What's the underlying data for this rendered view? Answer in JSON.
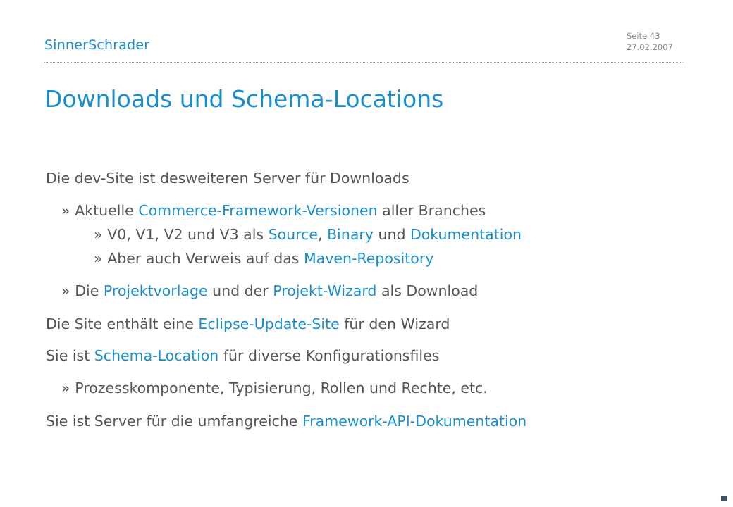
{
  "header": {
    "logo": "SinnerSchrader",
    "page_label": "Seite 43",
    "date": "27.02.2007"
  },
  "slide": {
    "title": "Downloads und Schema-Locations",
    "bullet": "»",
    "lines": [
      {
        "level": 1,
        "parts": [
          {
            "text": "Die dev-Site ist desweiteren Server für Downloads"
          }
        ]
      },
      {
        "level": 2,
        "parts": [
          {
            "text": "Aktuelle "
          },
          {
            "text": "Commerce-Framework-Versionen",
            "link": true
          },
          {
            "text": " aller Branches"
          }
        ]
      },
      {
        "level": 3,
        "parts": [
          {
            "text": "V0, V1, V2 und V3 als "
          },
          {
            "text": "Source",
            "link": true
          },
          {
            "text": ", "
          },
          {
            "text": "Binary",
            "link": true
          },
          {
            "text": " und "
          },
          {
            "text": "Dokumentation",
            "link": true
          }
        ]
      },
      {
        "level": 3,
        "parts": [
          {
            "text": "Aber auch Verweis auf das "
          },
          {
            "text": "Maven-Repository",
            "link": true
          }
        ]
      },
      {
        "level": 2,
        "parts": [
          {
            "text": "Die "
          },
          {
            "text": "Projektvorlage",
            "link": true
          },
          {
            "text": " und der "
          },
          {
            "text": "Projekt-Wizard",
            "link": true
          },
          {
            "text": " als Download"
          }
        ]
      },
      {
        "level": 1,
        "parts": [
          {
            "text": "Die Site enthält eine "
          },
          {
            "text": "Eclipse-Update-Site",
            "link": true
          },
          {
            "text": " für den Wizard"
          }
        ]
      },
      {
        "level": 1,
        "parts": [
          {
            "text": "Sie ist "
          },
          {
            "text": "Schema-Location",
            "link": true
          },
          {
            "text": " für diverse Konfigurationsfiles"
          }
        ]
      },
      {
        "level": 2,
        "parts": [
          {
            "text": "Prozesskomponente, Typisierung, Rollen und Rechte, etc."
          }
        ]
      },
      {
        "level": 1,
        "parts": [
          {
            "text": "Sie ist Server für die umfangreiche "
          },
          {
            "text": "Framework-API-Dokumentation",
            "link": true
          }
        ]
      }
    ]
  },
  "colors": {
    "accent": "#1a8fcc",
    "text": "#555555",
    "corner_mark": "#3f5166"
  }
}
